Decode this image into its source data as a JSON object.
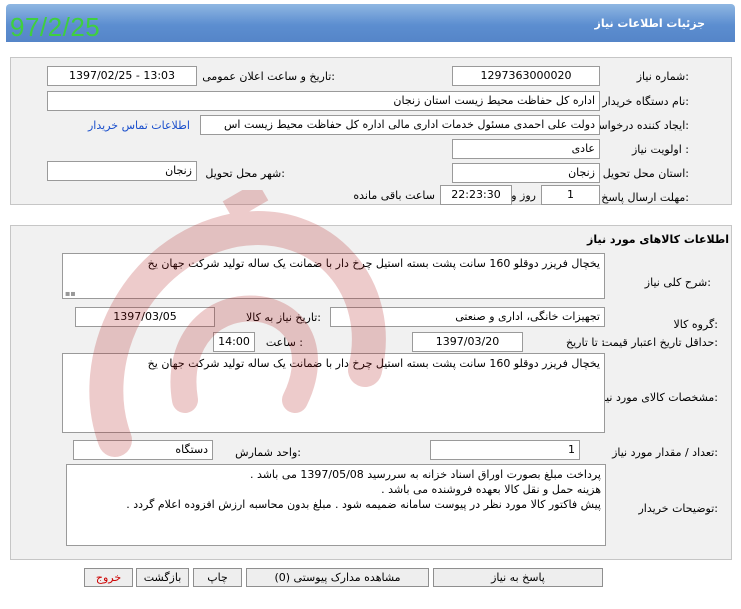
{
  "header": {
    "title": "جزئیات اطلاعات نیاز",
    "date_overlay": "97/2/25"
  },
  "fields": {
    "need_number": {
      "label": "شماره نیاز:",
      "value": "1297363000020"
    },
    "announce_datetime": {
      "label": "تاریخ و ساعت اعلان عمومی:",
      "value": "1397/02/25 - 13:03"
    },
    "buyer_org": {
      "label": "نام دستگاه خریدار:",
      "value": "اداره کل حفاظت محیط زیست استان زنجان"
    },
    "requester": {
      "label": "ایجاد کننده درخواست:",
      "value": "دولت علی احمدی مسئول خدمات اداری مالی اداره کل حفاظت محیط زیست اس"
    },
    "contact_link": "اطلاعات تماس خریدار",
    "priority": {
      "label": "اولویت نیاز :",
      "value": "عادی"
    },
    "province": {
      "label": "استان محل تحویل:",
      "value": "زنجان"
    },
    "city": {
      "label": "شهر محل تحویل:",
      "value": "زنجان"
    },
    "deadline": {
      "label": "مهلت ارسال پاسخ:",
      "days": "1",
      "days_label": "روز و",
      "time": "22:23:30",
      "remaining_label": "ساعت باقی مانده"
    }
  },
  "goods": {
    "section_title": "اطلاعات کالاهای مورد نیاز",
    "general_desc": {
      "label": "شرح کلی نیاز:",
      "value": "یخچال فریزر دوقلو 160 سانت پشت بسته استیل چرخ دار با ضمانت یک ساله تولید شرکت جهان یخ"
    },
    "group": {
      "label": "گروه کالا:",
      "value": "تجهیزات خانگی، اداری و صنعتی"
    },
    "need_date": {
      "label": "تاریخ نیاز به کالا:",
      "value": "1397/03/05"
    },
    "price_validity": {
      "label": "حداقل تاریخ اعتبار قیمت:",
      "to_date_label": "تا تاریخ :",
      "date": "1397/03/20",
      "time_label": "ساعت :",
      "time": "14:00"
    },
    "specs": {
      "label": "مشخصات کالای مورد نیاز:",
      "value": "یخچال فریزر دوقلو 160 سانت پشت بسته استیل چرخ دار با ضمانت یک ساله تولید شرکت جهان یخ"
    },
    "quantity": {
      "label": "تعداد / مقدار مورد نیاز:",
      "value": "1"
    },
    "unit": {
      "label": "واحد شمارش:",
      "value": "دستگاه"
    },
    "buyer_notes": {
      "label": "توضیحات خریدار:",
      "lines": [
        "پرداخت مبلغ بصورت اوراق اسناد خزانه به سررسید 1397/05/08 می باشد .",
        "هزینه حمل و نقل کالا بعهده فروشنده می باشد .",
        "پیش فاکتور کالا مورد نظر در پیوست سامانه ضمیمه شود . مبلغ بدون محاسبه ارزش افزوده اعلام گردد ."
      ]
    }
  },
  "buttons": {
    "respond": "پاسخ به نیاز",
    "view_attachments": "مشاهده مدارک پیوستی (0)",
    "print": "چاپ",
    "back": "بازگشت",
    "exit": "خروج"
  }
}
